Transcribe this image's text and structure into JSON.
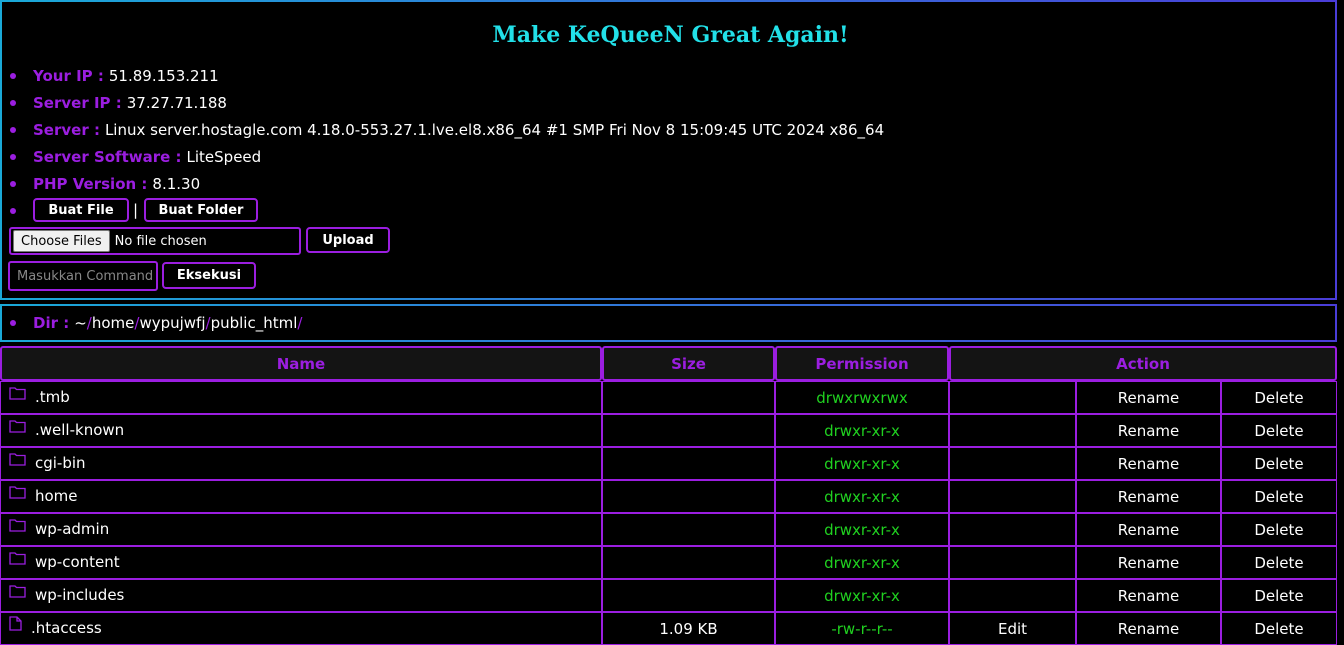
{
  "header": {
    "title": "Make KeQueeN Great Again!"
  },
  "info": [
    {
      "label": "Your IP :",
      "value": "51.89.153.211"
    },
    {
      "label": "Server IP :",
      "value": "37.27.71.188"
    },
    {
      "label": "Server :",
      "value": "Linux server.hostagle.com 4.18.0-553.27.1.lve.el8.x86_64 #1 SMP Fri Nov 8 15:09:45 UTC 2024 x86_64"
    },
    {
      "label": "Server Software :",
      "value": "LiteSpeed"
    },
    {
      "label": "PHP Version :",
      "value": "8.1.30"
    }
  ],
  "actions": {
    "buat_file": "Buat File",
    "separator": "|",
    "buat_folder": "Buat Folder",
    "choose_files": "Choose Files",
    "no_file": "No file chosen",
    "upload": "Upload",
    "command_placeholder": "Masukkan Command",
    "eksekusi": "Eksekusi"
  },
  "dir": {
    "label": "Dir :",
    "home_symbol": "~",
    "parts": [
      "home",
      "wypujwfj",
      "public_html"
    ],
    "slash": "/"
  },
  "table": {
    "headers": {
      "name": "Name",
      "size": "Size",
      "permission": "Permission",
      "action": "Action"
    },
    "rows": [
      {
        "icon": "folder-icon",
        "name": ".tmb",
        "size": "",
        "perm": "drwxrwxrwx",
        "edit": "",
        "rename": "Rename",
        "delete": "Delete"
      },
      {
        "icon": "folder-icon",
        "name": ".well-known",
        "size": "",
        "perm": "drwxr-xr-x",
        "edit": "",
        "rename": "Rename",
        "delete": "Delete"
      },
      {
        "icon": "folder-icon",
        "name": "cgi-bin",
        "size": "",
        "perm": "drwxr-xr-x",
        "edit": "",
        "rename": "Rename",
        "delete": "Delete"
      },
      {
        "icon": "folder-icon",
        "name": "home",
        "size": "",
        "perm": "drwxr-xr-x",
        "edit": "",
        "rename": "Rename",
        "delete": "Delete"
      },
      {
        "icon": "folder-icon",
        "name": "wp-admin",
        "size": "",
        "perm": "drwxr-xr-x",
        "edit": "",
        "rename": "Rename",
        "delete": "Delete"
      },
      {
        "icon": "folder-icon",
        "name": "wp-content",
        "size": "",
        "perm": "drwxr-xr-x",
        "edit": "",
        "rename": "Rename",
        "delete": "Delete"
      },
      {
        "icon": "folder-icon",
        "name": "wp-includes",
        "size": "",
        "perm": "drwxr-xr-x",
        "edit": "",
        "rename": "Rename",
        "delete": "Delete"
      },
      {
        "icon": "file-icon",
        "name": ".htaccess",
        "size": "1.09 KB",
        "perm": "-rw-r--r--",
        "edit": "Edit",
        "rename": "Rename",
        "delete": "Delete"
      }
    ]
  },
  "colors": {
    "accent": "#9b1ee0",
    "title": "#22e0e8",
    "perm": "#20d020",
    "border_blue": "#1e90ff"
  }
}
